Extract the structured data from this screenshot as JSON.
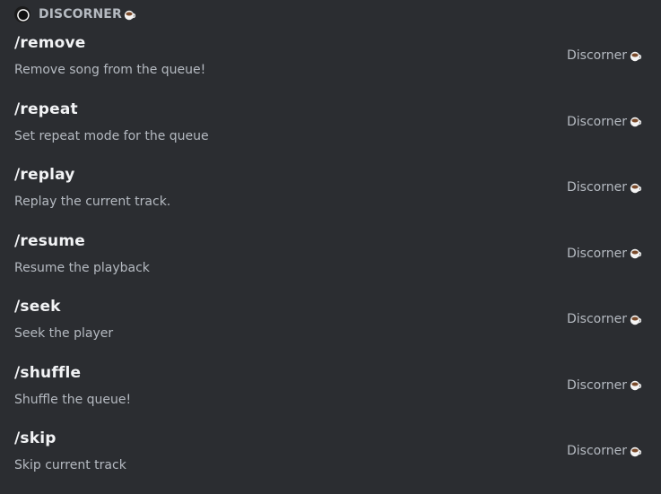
{
  "header": {
    "title": "DISCORNER",
    "avatar_icon": "bot-avatar-ring",
    "emoji_icon": "coffee-cup-icon"
  },
  "commands": [
    {
      "name": "/remove",
      "description": "Remove song from the queue!",
      "source": "Discorner"
    },
    {
      "name": "/repeat",
      "description": "Set repeat mode for the queue",
      "source": "Discorner"
    },
    {
      "name": "/replay",
      "description": "Replay the current track.",
      "source": "Discorner"
    },
    {
      "name": "/resume",
      "description": "Resume the playback",
      "source": "Discorner"
    },
    {
      "name": "/seek",
      "description": "Seek the player",
      "source": "Discorner"
    },
    {
      "name": "/shuffle",
      "description": "Shuffle the queue!",
      "source": "Discorner"
    },
    {
      "name": "/skip",
      "description": "Skip current track",
      "source": "Discorner"
    }
  ],
  "colors": {
    "background": "#2b2d31",
    "command_name": "#f2f3f5",
    "secondary_text": "#b5bac1"
  }
}
